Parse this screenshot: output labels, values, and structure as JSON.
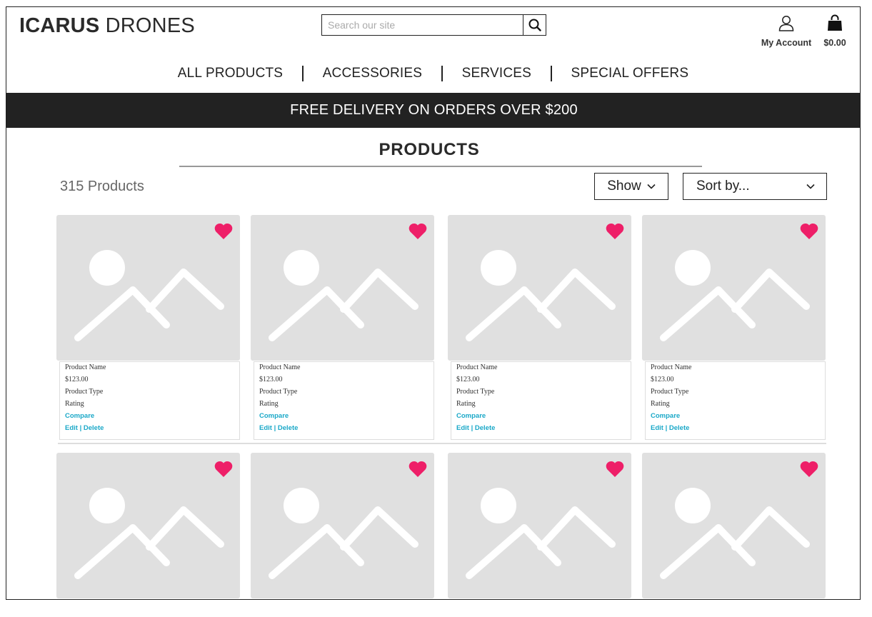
{
  "header": {
    "logo_bold": "ICARUS",
    "logo_light": "DRONES",
    "search_placeholder": "Search our site",
    "account_label": "My Account",
    "cart_total": "$0.00"
  },
  "nav": {
    "items": [
      "ALL PRODUCTS",
      "ACCESSORIES",
      "SERVICES",
      "SPECIAL OFFERS"
    ]
  },
  "banner": "FREE DELIVERY ON ORDERS OVER $200",
  "main": {
    "title": "PRODUCTS",
    "count": "315 Products",
    "show_label": "Show",
    "sort_label": "Sort by..."
  },
  "colors": {
    "heart": "#ee1f68",
    "link": "#1aa8c8",
    "banner_bg": "#222222",
    "placeholder_bg": "#e0e0e0"
  },
  "products": [
    {
      "name": "Product Name",
      "price": "$123.00",
      "type": "Product Type",
      "rating": "Rating",
      "compare": "Compare",
      "edit": "Edit",
      "delete": "Delete",
      "favorite": true
    },
    {
      "name": "Product Name",
      "price": "$123.00",
      "type": "Product Type",
      "rating": "Rating",
      "compare": "Compare",
      "edit": "Edit",
      "delete": "Delete",
      "favorite": true
    },
    {
      "name": "Product Name",
      "price": "$123.00",
      "type": "Product Type",
      "rating": "Rating",
      "compare": "Compare",
      "edit": "Edit",
      "delete": "Delete",
      "favorite": true
    },
    {
      "name": "Product Name",
      "price": "$123.00",
      "type": "Product Type",
      "rating": "Rating",
      "compare": "Compare",
      "edit": "Edit",
      "delete": "Delete",
      "favorite": true
    },
    {
      "favorite": true
    },
    {
      "favorite": true
    },
    {
      "favorite": true
    },
    {
      "favorite": true
    }
  ]
}
